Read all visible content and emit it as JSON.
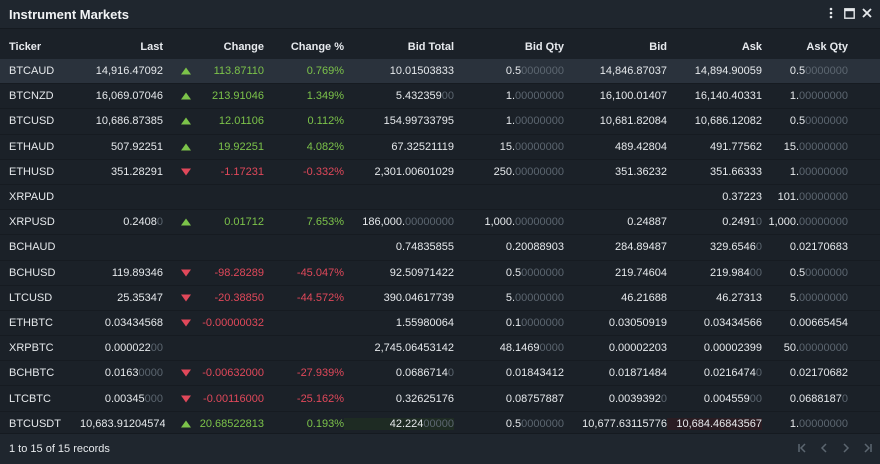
{
  "window": {
    "title": "Instrument Markets"
  },
  "columns": [
    "Ticker",
    "Last",
    "Change",
    "Change %",
    "Bid Total",
    "Bid Qty",
    "Bid",
    "Ask",
    "Ask Qty"
  ],
  "rows": [
    {
      "ticker": "BTCAUD",
      "last": "14,916.47092",
      "last_dim": "",
      "dir": "up",
      "change": "113.87110",
      "changep": "0.769%",
      "bidtot": "10.01503833",
      "bidtot_dim": "",
      "bidqty": "0.5",
      "bidqty_dim": "0000000",
      "bid": "14,846.87037",
      "bid_dim": "",
      "ask": "14,894.90059",
      "ask_dim": "",
      "askqty": "0.5",
      "askqty_dim": "0000000"
    },
    {
      "ticker": "BTCNZD",
      "last": "16,069.07046",
      "last_dim": "",
      "dir": "up",
      "change": "213.91046",
      "changep": "1.349%",
      "bidtot": "5.432359",
      "bidtot_dim": "00",
      "bidqty": "1.",
      "bidqty_dim": "00000000",
      "bid": "16,100.01407",
      "bid_dim": "",
      "ask": "16,140.40331",
      "ask_dim": "",
      "askqty": "1.",
      "askqty_dim": "00000000"
    },
    {
      "ticker": "BTCUSD",
      "last": "10,686.87385",
      "last_dim": "",
      "dir": "up",
      "change": "12.01106",
      "changep": "0.112%",
      "bidtot": "154.99733795",
      "bidtot_dim": "",
      "bidqty": "1.",
      "bidqty_dim": "00000000",
      "bid": "10,681.82084",
      "bid_dim": "",
      "ask": "10,686.12082",
      "ask_dim": "",
      "askqty": "0.5",
      "askqty_dim": "0000000"
    },
    {
      "ticker": "ETHAUD",
      "last": "507.92251",
      "last_dim": "",
      "dir": "up",
      "change": "19.92251",
      "changep": "4.082%",
      "bidtot": "67.32521119",
      "bidtot_dim": "",
      "bidqty": "15.",
      "bidqty_dim": "00000000",
      "bid": "489.42804",
      "bid_dim": "",
      "ask": "491.77562",
      "ask_dim": "",
      "askqty": "15.",
      "askqty_dim": "00000000"
    },
    {
      "ticker": "ETHUSD",
      "last": "351.28291",
      "last_dim": "",
      "dir": "down",
      "change": "-1.17231",
      "changep": "-0.332%",
      "bidtot": "2,301.00601029",
      "bidtot_dim": "",
      "bidqty": "250.",
      "bidqty_dim": "00000000",
      "bid": "351.36232",
      "bid_dim": "",
      "ask": "351.66333",
      "ask_dim": "",
      "askqty": "1.",
      "askqty_dim": "00000000"
    },
    {
      "ticker": "XRPAUD",
      "last": "",
      "last_dim": "",
      "dir": "",
      "change": "",
      "changep": "",
      "bidtot": "",
      "bidtot_dim": "",
      "bidqty": "",
      "bidqty_dim": "",
      "bid": "",
      "bid_dim": "",
      "ask": "0.37223",
      "ask_dim": "",
      "askqty": "101.",
      "askqty_dim": "00000000"
    },
    {
      "ticker": "XRPUSD",
      "last": "0.2408",
      "last_dim": "0",
      "dir": "up",
      "change": "0.01712",
      "changep": "7.653%",
      "bidtot": "186,000.",
      "bidtot_dim": "00000000",
      "bidqty": "1,000.",
      "bidqty_dim": "00000000",
      "bid": "0.24887",
      "bid_dim": "",
      "ask": "0.2491",
      "ask_dim": "0",
      "askqty": "1,000.",
      "askqty_dim": "00000000"
    },
    {
      "ticker": "BCHAUD",
      "last": "",
      "last_dim": "",
      "dir": "",
      "change": "",
      "changep": "",
      "bidtot": "0.74835855",
      "bidtot_dim": "",
      "bidqty": "0.20088903",
      "bidqty_dim": "",
      "bid": "284.89487",
      "bid_dim": "",
      "ask": "329.6546",
      "ask_dim": "0",
      "askqty": "0.02170683",
      "askqty_dim": ""
    },
    {
      "ticker": "BCHUSD",
      "last": "119.89346",
      "last_dim": "",
      "dir": "down",
      "change": "-98.28289",
      "changep": "-45.047%",
      "bidtot": "92.50971422",
      "bidtot_dim": "",
      "bidqty": "0.5",
      "bidqty_dim": "0000000",
      "bid": "219.74604",
      "bid_dim": "",
      "ask": "219.984",
      "ask_dim": "00",
      "askqty": "0.5",
      "askqty_dim": "0000000"
    },
    {
      "ticker": "LTCUSD",
      "last": "25.35347",
      "last_dim": "",
      "dir": "down",
      "change": "-20.38850",
      "changep": "-44.572%",
      "bidtot": "390.04617739",
      "bidtot_dim": "",
      "bidqty": "5.",
      "bidqty_dim": "00000000",
      "bid": "46.21688",
      "bid_dim": "",
      "ask": "46.27313",
      "ask_dim": "",
      "askqty": "5.",
      "askqty_dim": "00000000"
    },
    {
      "ticker": "ETHBTC",
      "last": "0.03434568",
      "last_dim": "",
      "dir": "down",
      "change": "-0.00000032",
      "changep": "",
      "bidtot": "1.55980064",
      "bidtot_dim": "",
      "bidqty": "0.1",
      "bidqty_dim": "0000000",
      "bid": "0.03050919",
      "bid_dim": "",
      "ask": "0.03434566",
      "ask_dim": "",
      "askqty": "0.00665454",
      "askqty_dim": ""
    },
    {
      "ticker": "XRPBTC",
      "last": "0.000022",
      "last_dim": "00",
      "dir": "",
      "change": "",
      "changep": "",
      "bidtot": "2,745.06453142",
      "bidtot_dim": "",
      "bidqty": "48.1469",
      "bidqty_dim": "0000",
      "bid": "0.00002203",
      "bid_dim": "",
      "ask": "0.00002399",
      "ask_dim": "",
      "askqty": "50.",
      "askqty_dim": "00000000"
    },
    {
      "ticker": "BCHBTC",
      "last": "0.0163",
      "last_dim": "0000",
      "dir": "down",
      "change": "-0.00632000",
      "changep": "-27.939%",
      "bidtot": "0.0686714",
      "bidtot_dim": "0",
      "bidqty": "0.01843412",
      "bidqty_dim": "",
      "bid": "0.01871484",
      "bid_dim": "",
      "ask": "0.0216474",
      "ask_dim": "0",
      "askqty": "0.02170682",
      "askqty_dim": ""
    },
    {
      "ticker": "LTCBTC",
      "last": "0.00345",
      "last_dim": "000",
      "dir": "down",
      "change": "-0.00116000",
      "changep": "-25.162%",
      "bidtot": "0.32625176",
      "bidtot_dim": "",
      "bidqty": "0.08757887",
      "bidqty_dim": "",
      "bid": "0.0039392",
      "bid_dim": "0",
      "ask": "0.004559",
      "ask_dim": "00",
      "askqty": "0.0688187",
      "askqty_dim": "0"
    },
    {
      "ticker": "BTCUSDT",
      "last": "10,683.91204574",
      "last_dim": "",
      "dir": "up",
      "change": "20.68522813",
      "changep": "0.193%",
      "bidtot": "42.224",
      "bidtot_dim": "00000",
      "bidqty": "0.5",
      "bidqty_dim": "0000000",
      "bid": "10,677.63115776",
      "bid_dim": "",
      "ask": "10,684.46843567",
      "ask_dim": "",
      "askqty": "1.",
      "askqty_dim": "00000000"
    }
  ],
  "footer": {
    "records": "1 to 15 of 15 records"
  },
  "colors": {
    "background": "#1b2128",
    "up": "#7cc34a",
    "down": "#e0485a",
    "dim": "#5c6670",
    "selected_row": "#2a323c"
  },
  "icons": [
    "kebab-menu-icon",
    "maximize-icon",
    "close-icon",
    "first-page-icon",
    "prev-page-icon",
    "next-page-icon",
    "last-page-icon",
    "up-arrow-icon",
    "down-arrow-icon"
  ]
}
